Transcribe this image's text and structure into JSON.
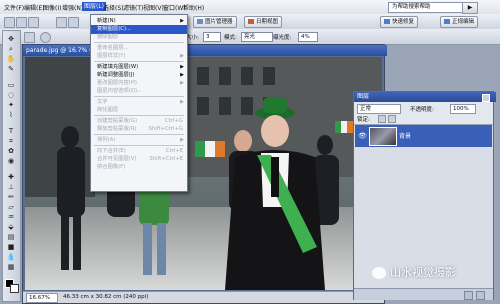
{
  "menubar": {
    "items": [
      "文件(F)",
      "编辑(E)",
      "图像(I)",
      "增强(N)",
      "图层(L)",
      "选择(S)",
      "滤镜(T)",
      "视图(V)",
      "窗口(W)",
      "帮助(H)"
    ],
    "active_index": 4,
    "help_field_value": "为帮助搜索帮助",
    "help_go": "▶"
  },
  "toolbar": {
    "organizer_button": "图片管理器",
    "date_view_button": "日期视图",
    "quick_fix_button": "快速修复",
    "standard_edit_button": "正规编辑"
  },
  "options_bar": {
    "size_label": "大小:",
    "size_value": "3",
    "mode_label": "模式:",
    "mode_value": "亮光",
    "exposure_label": "曝光度:",
    "exposure_value": "4%"
  },
  "document": {
    "title": "parade.jpg @ 16.7% (背景, RGB/8)",
    "zoom": "16.67%",
    "dimensions": "46.33 cm x 30.82 cm (240 ppi)",
    "accent": "#2b58c8"
  },
  "layer_menu": {
    "items": [
      {
        "label": "新建(N)",
        "shortcut": "",
        "submenu": true,
        "disabled": false,
        "selected": false
      },
      {
        "label": "复制图层(C)...",
        "shortcut": "",
        "submenu": false,
        "disabled": false,
        "selected": true
      },
      {
        "label": "删除图层",
        "shortcut": "",
        "submenu": false,
        "disabled": true,
        "selected": false
      },
      {
        "sep": true
      },
      {
        "label": "重命名图层...",
        "shortcut": "",
        "submenu": false,
        "disabled": true,
        "selected": false
      },
      {
        "label": "图层样式(Y)",
        "shortcut": "",
        "submenu": true,
        "disabled": true,
        "selected": false
      },
      {
        "sep": true
      },
      {
        "label": "新建填充图层(W)",
        "shortcut": "",
        "submenu": true,
        "disabled": false,
        "selected": false
      },
      {
        "label": "新建调整图层(J)",
        "shortcut": "",
        "submenu": true,
        "disabled": false,
        "selected": false
      },
      {
        "label": "更改图层内容(H)",
        "shortcut": "",
        "submenu": true,
        "disabled": true,
        "selected": false
      },
      {
        "label": "图层内容选项(O)...",
        "shortcut": "",
        "submenu": false,
        "disabled": true,
        "selected": false
      },
      {
        "sep": true
      },
      {
        "label": "文字",
        "shortcut": "",
        "submenu": true,
        "disabled": true,
        "selected": false
      },
      {
        "label": "简化图层",
        "shortcut": "",
        "submenu": false,
        "disabled": true,
        "selected": false
      },
      {
        "sep": true
      },
      {
        "label": "创建剪贴蒙版(G)",
        "shortcut": "Ctrl+G",
        "submenu": false,
        "disabled": true,
        "selected": false
      },
      {
        "label": "释放剪贴蒙版(R)",
        "shortcut": "Shift+Ctrl+G",
        "submenu": false,
        "disabled": true,
        "selected": false
      },
      {
        "sep": true
      },
      {
        "label": "排列(A)",
        "shortcut": "",
        "submenu": true,
        "disabled": true,
        "selected": false
      },
      {
        "sep": true
      },
      {
        "label": "向下合并(E)",
        "shortcut": "Ctrl+E",
        "submenu": false,
        "disabled": true,
        "selected": false
      },
      {
        "label": "合并可见图层(V)",
        "shortcut": "Shift+Ctrl+E",
        "submenu": false,
        "disabled": true,
        "selected": false
      },
      {
        "label": "拼合图像(F)",
        "shortcut": "",
        "submenu": false,
        "disabled": true,
        "selected": false
      }
    ]
  },
  "layers_panel": {
    "title": "图层",
    "blend_mode": "正常",
    "opacity_label": "不透明度:",
    "opacity_value": "100%",
    "lock_label": "锁定:",
    "layer_name": "背景"
  },
  "watermark": "山水视觉摄影"
}
